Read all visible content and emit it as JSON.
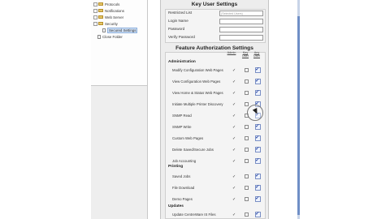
{
  "tree": {
    "items": [
      {
        "label": "Protocols"
      },
      {
        "label": "Notifications"
      },
      {
        "label": "Web Server"
      },
      {
        "label": "Security"
      },
      {
        "label": "Secured Settings"
      },
      {
        "label": "Close Folder"
      }
    ]
  },
  "key_user": {
    "title": "Key User Settings",
    "fields": [
      {
        "label": "Restricted List",
        "value": "(Selected Users)"
      },
      {
        "label": "Login Name",
        "value": ""
      },
      {
        "label": "Password",
        "value": ""
      },
      {
        "label": "Verify Password",
        "value": ""
      }
    ]
  },
  "features": {
    "title": "Feature Authorization Settings",
    "columns": {
      "admin": "Admin",
      "key_user": "Key User",
      "any_user": "Any User"
    },
    "groups": [
      {
        "name": "Administration",
        "rows": [
          {
            "label": "Modify Configuration Web Pages",
            "admin": "✓",
            "key": false,
            "any": "✓"
          },
          {
            "label": "View Configuration Web Pages",
            "admin": "✓",
            "key": false,
            "any": "✓"
          },
          {
            "label": "View Home & Status Web Pages",
            "admin": "✓",
            "key": false,
            "any": "✓"
          },
          {
            "label": "Initiate Multiple Printer Discovery",
            "admin": "✓",
            "key": false,
            "any": "✓"
          },
          {
            "label": "SNMP Read",
            "admin": "✓",
            "key": false,
            "any": "✓"
          },
          {
            "label": "SNMP Write",
            "admin": "✓",
            "key": false,
            "any": "✓"
          },
          {
            "label": "Custom Web Pages",
            "admin": "✓",
            "key": false,
            "any": "✓"
          },
          {
            "label": "Delete Saved/Secure Jobs",
            "admin": "✓",
            "key": false,
            "any": "✓"
          },
          {
            "label": "Job Accounting",
            "admin": "✓",
            "key": false,
            "any": "✓"
          }
        ]
      },
      {
        "name": "Printing",
        "rows": [
          {
            "label": "Saved Jobs",
            "admin": "✓",
            "key": false,
            "any": "✓"
          },
          {
            "label": "File Download",
            "admin": "✓",
            "key": false,
            "any": "✓"
          },
          {
            "label": "Demo Pages",
            "admin": "✓",
            "key": false,
            "any": "✓"
          }
        ]
      },
      {
        "name": "Updates",
        "rows": [
          {
            "label": "Update CentreWare IS Files",
            "admin": "✓",
            "key": false,
            "any": "✓"
          }
        ]
      }
    ]
  }
}
